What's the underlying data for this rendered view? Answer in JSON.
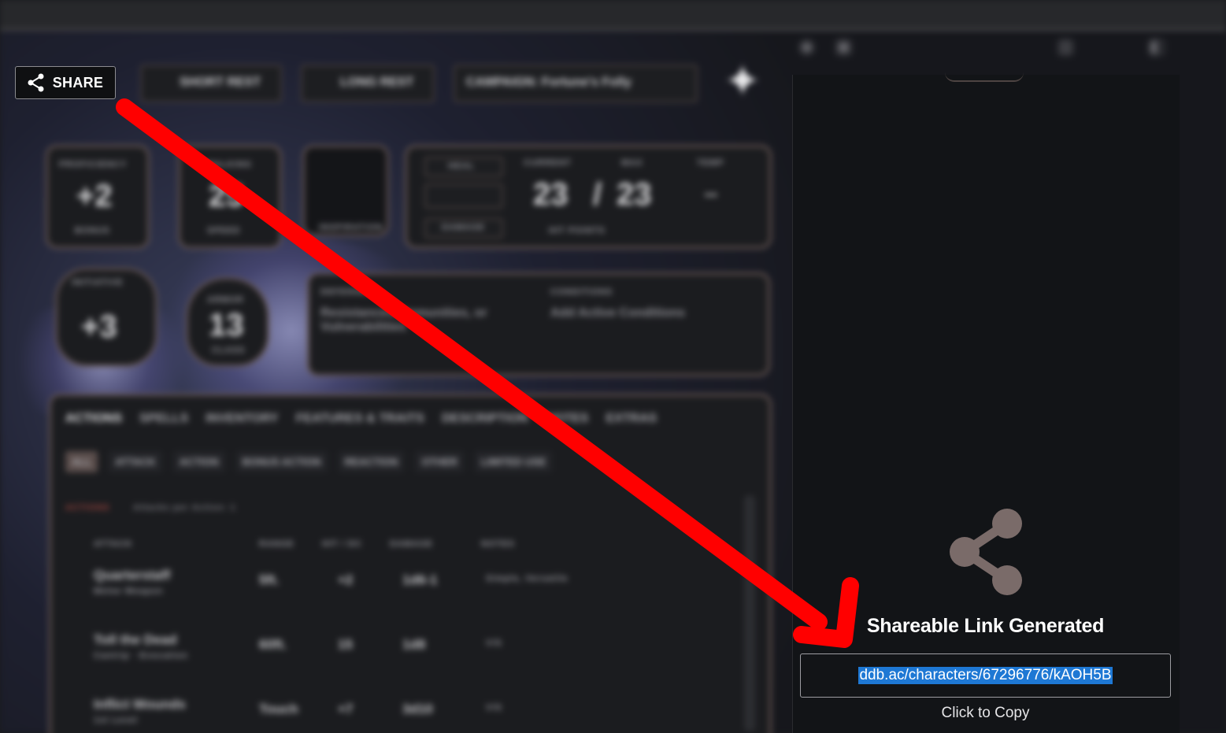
{
  "toolbar": {
    "share_label": "SHARE",
    "short_rest_label": "SHORT REST",
    "long_rest_label": "LONG REST",
    "campaign_label": "CAMPAIGN: Fortune's Folly"
  },
  "stats": {
    "proficiency_label": "PROFICIENCY",
    "proficiency_value": "+2",
    "proficiency_sub": "BONUS",
    "walking_label": "WALKING",
    "walking_value": "25",
    "walking_sub": "SPEED",
    "inspiration_label": "INSPIRATION",
    "initiative_label": "INITIATIVE",
    "initiative_value": "+3",
    "armor_label": "ARMOR",
    "armor_value": "13",
    "armor_sub": "CLASS",
    "hp_current_label": "CURRENT",
    "hp_max_label": "MAX",
    "hp_temp_label": "TEMP",
    "hp_current": "23",
    "hp_separator": "/",
    "hp_max": "23",
    "hp_temp": "--",
    "hp_label": "HIT POINTS",
    "heal_label": "HEAL",
    "damage_label": "DAMAGE",
    "defenses_label": "DEFENSES",
    "defenses_text": "Resistances, Immunities, or Vulnerabilities",
    "conditions_label": "CONDITIONS",
    "conditions_text": "Add Active Conditions"
  },
  "tabs": [
    "ACTIONS",
    "SPELLS",
    "INVENTORY",
    "FEATURES & TRAITS",
    "DESCRIPTION",
    "NOTES",
    "EXTRAS"
  ],
  "subtabs": [
    "ALL",
    "ATTACK",
    "ACTION",
    "BONUS ACTION",
    "REACTION",
    "OTHER",
    "LIMITED USE"
  ],
  "actions": {
    "header": "ACTIONS",
    "attacks_per_action": "Attacks per Action: 1",
    "columns": [
      "ATTACK",
      "RANGE",
      "HIT / DC",
      "DAMAGE",
      "NOTES"
    ],
    "rows": [
      {
        "name": "Quarterstaff",
        "sub": "Melee Weapon",
        "range": "5ft.",
        "hit": "+2",
        "damage": "1d6-1",
        "notes": "Simple, Versatile"
      },
      {
        "name": "Toll the Dead",
        "sub": "Cantrip · Evocation",
        "range": "60ft.",
        "hit": "15",
        "damage": "1d8",
        "notes": "V/S"
      },
      {
        "name": "Inflict Wounds",
        "sub": "1st Level",
        "range": "Touch",
        "hit": "+7",
        "damage": "3d10",
        "notes": "V/S"
      }
    ]
  },
  "share_panel": {
    "title": "Shareable Link Generated",
    "link": "ddb.ac/characters/67296776/kAOH5B",
    "copy_hint": "Click to Copy"
  },
  "colors": {
    "arrow": "#ff0000",
    "selection": "#1e78d4",
    "share_icon": "#7a6b69",
    "frame": "#6b5a55"
  }
}
